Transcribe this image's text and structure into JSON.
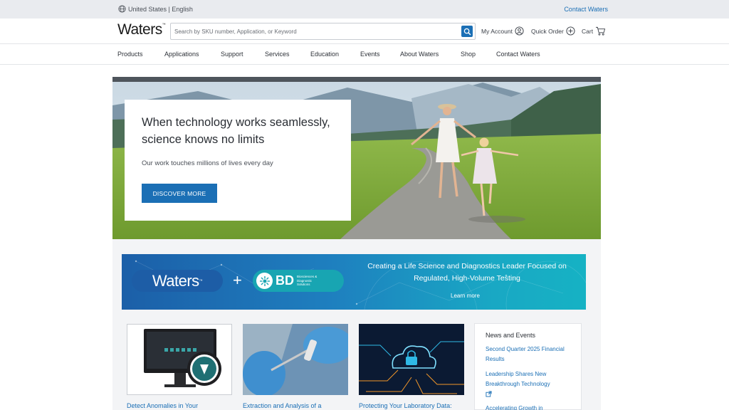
{
  "utility": {
    "locale": "United States | English",
    "contact": "Contact Waters"
  },
  "header": {
    "logo": "Waters",
    "logo_tm": "™",
    "search_placeholder": "Search by SKU number, Application, or Keyword",
    "my_account": "My Account",
    "quick_order": "Quick Order",
    "cart": "Cart"
  },
  "nav": {
    "items": [
      "Products",
      "Applications",
      "Support",
      "Services",
      "Education",
      "Events",
      "About Waters",
      "Shop",
      "Contact Waters"
    ]
  },
  "hero": {
    "title": "When technology works seamlessly, science knows no limits",
    "subtitle": "Our work touches millions of lives every day",
    "cta": "DISCOVER MORE"
  },
  "banner": {
    "waters": "Waters",
    "waters_tm": "™",
    "plus": "+",
    "bd": "BD",
    "bd_sub": "Biosciences & Diagnostic Solutions",
    "headline": "Creating a Life Science and Diagnostics Leader Focused on Regulated, High-Volume Testing",
    "learn_more": "Learn more"
  },
  "cards": [
    {
      "title": "Detect Anomalies in Your"
    },
    {
      "title": "Extraction and Analysis of a"
    },
    {
      "title": "Protecting Your Laboratory Data:"
    }
  ],
  "news": {
    "heading": "News and Events",
    "items": [
      "Second Quarter 2025 Financial Results",
      "Leadership Shares New Breakthrough Technology",
      "Accelerating Growth in"
    ]
  },
  "colors": {
    "accent": "#1b6fb5",
    "utility_bg": "#e9ebef",
    "banner_start": "#1c5fa8",
    "banner_end": "#16b2c4"
  }
}
